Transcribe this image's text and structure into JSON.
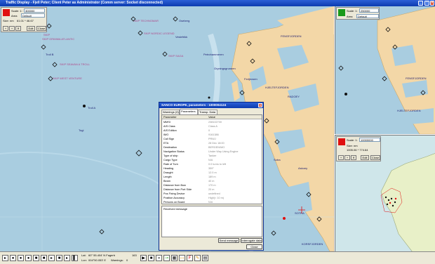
{
  "window": {
    "title": "Traffic Display - Fjell Peter; Client Peter as Administrator  (Comm server: Socket disconnected)"
  },
  "colors": {
    "sea": "#a9cde0",
    "land": "#f3d7a7",
    "ais_red": "#e01010",
    "green": "#1a9a1a"
  },
  "main_ctrl": {
    "scale_label": "Scale: 1:",
    "scale_value": "300000",
    "area_label": "Area",
    "area_value": "Default",
    "size_label": "Size: nm",
    "size_value": "61.01 * 46.67",
    "edit_label": "Edit",
    "close_label": "Close"
  },
  "top_right_ctrl": {
    "scale_label": "Scale: 1:",
    "scale_value": "250000",
    "area_label": "Area",
    "area_value": "Default"
  },
  "bottom_right_ctrl": {
    "scale_label": "Scale: 1:",
    "scale_value": "10000000",
    "size_label": "Size: nm",
    "size_value": "1005.06 * 774.64",
    "edit_label": "Edit",
    "close_label": "Close"
  },
  "map_labels": {
    "m1": "SKIP\nGRIMMA ATLANTIC",
    "m2": "Troll B",
    "m3": "SKIP\nSEAVAN A TROLL",
    "m4": "SKIP\nWEST VENTURE",
    "m5": "Oseberg",
    "m6": "Veslefrikk",
    "m7": "SKIP\nTECHNOMAR",
    "m8": "SKIP\nNORDIC LEGEND",
    "m9": "Petrohammeren",
    "m10": "Gryningsgrunnen",
    "m11": "Fedjeosen",
    "m12": "FENSFJORDEN",
    "m13": "HJELTEFJORDEN",
    "m14": "RADOEY",
    "m15": "Sotra",
    "m16": "Askoey",
    "m17": "KORSFJORDEN",
    "m18": "Troll A",
    "m19": "Togi",
    "m20": "NORDFJORDEN",
    "m21": "BJORNEFJORDEN",
    "m22": "SOTRA",
    "m23": "SKIP\nSAGA",
    "m24": "SKIP\nSMART"
  },
  "dialog": {
    "title": "SANCO EUROPE, parameters - 1000004124",
    "tabs": [
      "Warnings (0)",
      "Parameters",
      "Transp. Data"
    ],
    "col_param": "Parameter",
    "col_value": "Value",
    "rows": [
      {
        "k": "MMSI",
        "v": "238102700"
      },
      {
        "k": "AIS Class",
        "v": "Class A"
      },
      {
        "k": "AIS Edition",
        "v": "0"
      },
      {
        "k": "IMO",
        "v": "9161386"
      },
      {
        "k": "Call Sign",
        "v": "PRWJ"
      },
      {
        "k": "ETA",
        "v": "28 Dec 18:00"
      },
      {
        "k": "Destination",
        "v": "BERGEN/MO"
      },
      {
        "k": "Navigation Status",
        "v": "Under Way Using Engine"
      },
      {
        "k": "Type of ship",
        "v": "Tanker"
      },
      {
        "k": "Cargo Type",
        "v": "N/A"
      },
      {
        "k": "Rate of Turn",
        "v": "0.0 turns to left"
      },
      {
        "k": "Heading",
        "v": "359°"
      },
      {
        "k": "Draught",
        "v": "12.0 m"
      },
      {
        "k": "Length",
        "v": "189 m"
      },
      {
        "k": "Beam",
        "v": "40 m"
      },
      {
        "k": "Distance from Bow",
        "v": "170 m"
      },
      {
        "k": "Distance from Port Side",
        "v": "20 m"
      },
      {
        "k": "Pos Fixing Device",
        "v": "undefined"
      },
      {
        "k": "Position Accuracy",
        "v": "High(< 10 m)"
      },
      {
        "k": "Persons on Board",
        "v": "N/A"
      }
    ],
    "received_label": "Received message",
    "send_label": "Send message",
    "interrogate_label": "Interrogate data",
    "close_label": "Close"
  },
  "status": {
    "lat_label": "Lat:",
    "lat_value": "60° 55.404' N Fagerb",
    "lon_label": "Lon:",
    "lon_value": "004°50.053' E",
    "warnings_label": "Warnings:",
    "warnings_value": "0",
    "count_value": "163"
  }
}
